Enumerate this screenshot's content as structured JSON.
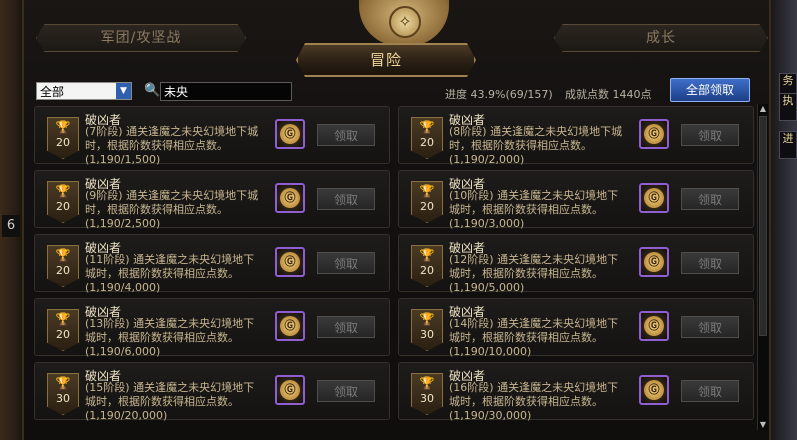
{
  "side": {
    "right_tags": [
      "务",
      "执",
      "进"
    ],
    "left_tag": "6"
  },
  "tabs": {
    "left": "军团/攻坚战",
    "active": "冒险",
    "right": "成长"
  },
  "filter": {
    "select_value": "全部",
    "search_value": "未央"
  },
  "stats": {
    "progress_text": "进度  43.9%(69/157)",
    "points_text": "成就点数  1440点"
  },
  "claim_all_label": "全部领取",
  "cards": [
    {
      "title": "破凶者",
      "desc": "(7阶段) 通关逢魔之未央幻境地下城时，根据阶数获得相应点数。",
      "progress": "(1,190/1,500)",
      "points": "20",
      "claim": "领取"
    },
    {
      "title": "破凶者",
      "desc": "(8阶段) 通关逢魔之未央幻境地下城时，根据阶数获得相应点数。",
      "progress": "(1,190/2,000)",
      "points": "20",
      "claim": "领取"
    },
    {
      "title": "破凶者",
      "desc": "(9阶段) 通关逢魔之未央幻境地下城时，根据阶数获得相应点数。",
      "progress": "(1,190/2,500)",
      "points": "20",
      "claim": "领取"
    },
    {
      "title": "破凶者",
      "desc": "(10阶段) 通关逢魔之未央幻境地下城时，根据阶数获得相应点数。",
      "progress": "(1,190/3,000)",
      "points": "20",
      "claim": "领取"
    },
    {
      "title": "破凶者",
      "desc": "(11阶段) 通关逢魔之未央幻境地下城时，根据阶数获得相应点数。",
      "progress": "(1,190/4,000)",
      "points": "20",
      "claim": "领取"
    },
    {
      "title": "破凶者",
      "desc": "(12阶段) 通关逢魔之未央幻境地下城时，根据阶数获得相应点数。",
      "progress": "(1,190/5,000)",
      "points": "20",
      "claim": "领取"
    },
    {
      "title": "破凶者",
      "desc": "(13阶段) 通关逢魔之未央幻境地下城时，根据阶数获得相应点数。",
      "progress": "(1,190/6,000)",
      "points": "20",
      "claim": "领取"
    },
    {
      "title": "破凶者",
      "desc": "(14阶段) 通关逢魔之未央幻境地下城时，根据阶数获得相应点数。",
      "progress": "(1,190/10,000)",
      "points": "30",
      "claim": "领取"
    },
    {
      "title": "破凶者",
      "desc": "(15阶段) 通关逢魔之未央幻境地下城时，根据阶数获得相应点数。",
      "progress": "(1,190/20,000)",
      "points": "30",
      "claim": "领取"
    },
    {
      "title": "破凶者",
      "desc": "(16阶段) 通关逢魔之未央幻境地下城时，根据阶数获得相应点数。",
      "progress": "(1,190/30,000)",
      "points": "30",
      "claim": "领取"
    }
  ]
}
